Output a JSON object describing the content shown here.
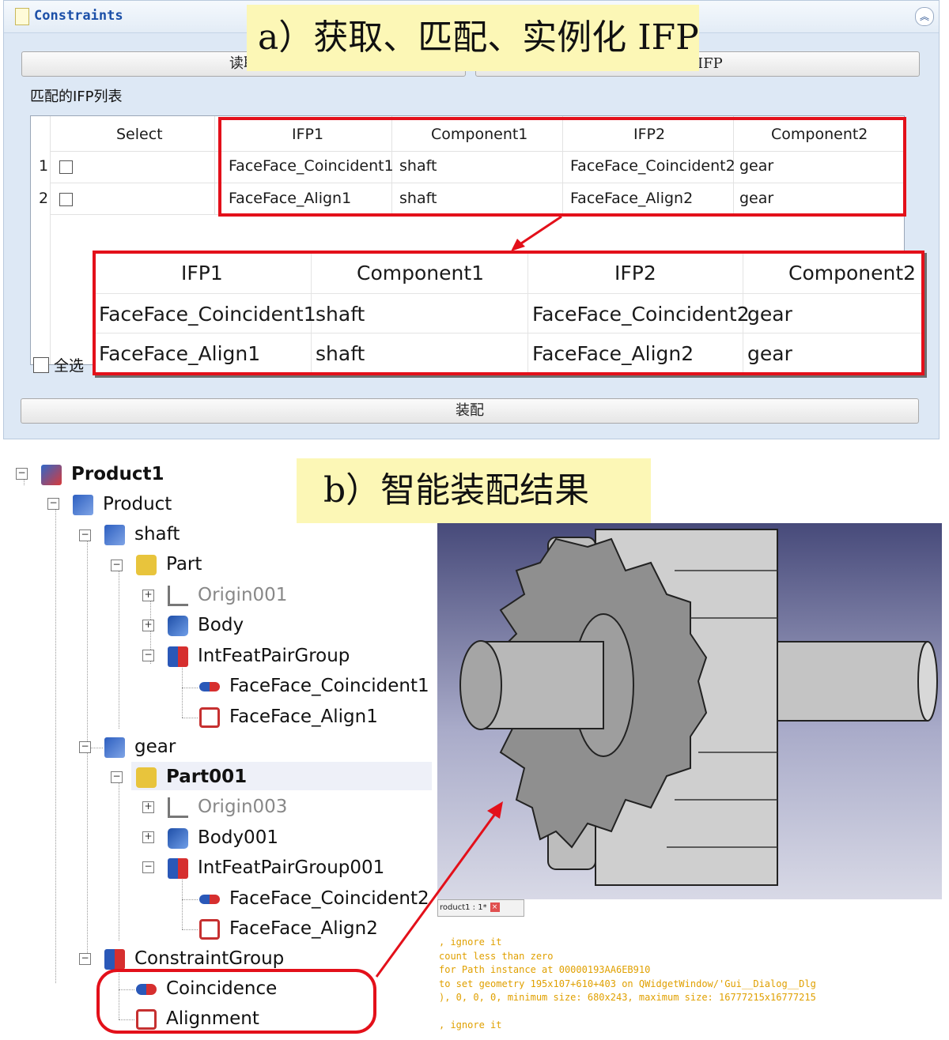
{
  "panel_a": {
    "title": "Constraints",
    "read_button": "读取",
    "instantiate_button_partial": "IFP",
    "list_label": "匹配的IFP列表",
    "table": {
      "headers": [
        "Select",
        "IFP1",
        "Component1",
        "IFP2",
        "Component2"
      ],
      "rows": [
        {
          "index": "1",
          "ifp1": "FaceFace_Coincident1",
          "component1": "shaft",
          "ifp2": "FaceFace_Coincident2",
          "component2": "gear"
        },
        {
          "index": "2",
          "ifp1": "FaceFace_Align1",
          "component1": "shaft",
          "ifp2": "FaceFace_Align2",
          "component2": "gear"
        }
      ]
    },
    "select_all_label": "全选",
    "assemble_button": "装配",
    "caption": "a）获取、匹配、实例化 IFP"
  },
  "panel_b": {
    "caption": "b）智能装配结果",
    "tree": {
      "product1": "Product1",
      "product": "Product",
      "shaft": "shaft",
      "part": "Part",
      "origin001": "Origin001",
      "body": "Body",
      "intfeatpairgroup": "IntFeatPairGroup",
      "coincident1": "FaceFace_Coincident1",
      "align1": "FaceFace_Align1",
      "gear": "gear",
      "part001": "Part001",
      "origin003": "Origin003",
      "body001": "Body001",
      "intfeatpairgroup001": "IntFeatPairGroup001",
      "coincident2": "FaceFace_Coincident2",
      "align2": "FaceFace_Align2",
      "constraintgroup": "ConstraintGroup",
      "coincidence": "Coincidence",
      "alignment": "Alignment"
    },
    "doc_tab": "roduct1 : 1*",
    "report_lines": [
      ", ignore it",
      " count less than zero",
      "for Path instance at 00000193AA6EB910",
      "to set geometry 195x107+610+403 on QWidgetWindow/'Gui__Dialog__Dlg",
      "), 0, 0, 0, minimum size: 680x243, maximum size: 16777215x16777215",
      ", ignore it"
    ]
  },
  "colors": {
    "highlight": "#e3101a",
    "caption_bg": "#fcf7b6",
    "panel_bg": "#dde8f5"
  }
}
